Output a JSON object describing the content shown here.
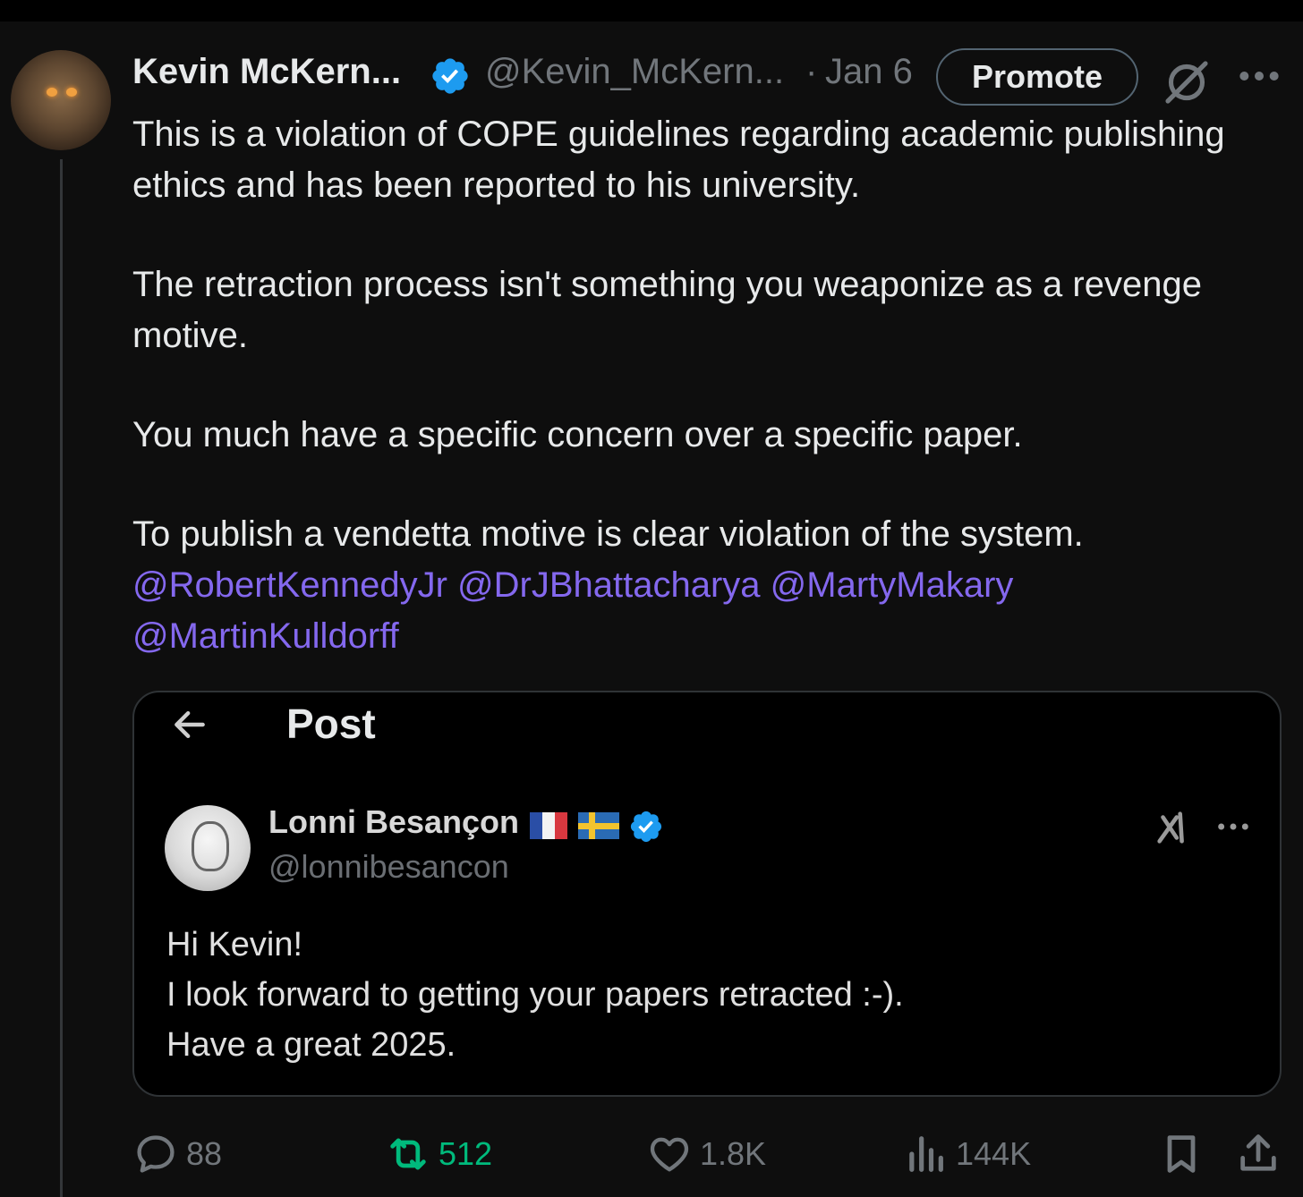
{
  "post": {
    "author_name": "Kevin McKern...",
    "author_handle": "@Kevin_McKern...",
    "separator": "·",
    "date": "Jan 6",
    "promote_label": "Promote",
    "paragraphs": [
      "This is a violation of COPE guidelines regarding academic publishing ethics and has been reported to his university.",
      "The retraction process isn't something you weaponize as a revenge motive.",
      "You much have a specific concern over a specific paper.",
      "To publish a vendetta motive is clear violation of the system."
    ],
    "mentions": [
      "@RobertKennedyJr",
      "@DrJBhattacharya",
      "@MartyMakary",
      "@MartinKulldorff"
    ]
  },
  "quoted": {
    "header_title": "Post",
    "author_name": "Lonni Besançon",
    "author_handle": "@lonnibesancon",
    "text": "Hi Kevin!\nI look forward to getting your papers retracted :-).\nHave a great 2025."
  },
  "actions": {
    "replies": "88",
    "reposts": "512",
    "likes": "1.8K",
    "views": "144K"
  },
  "icons": {
    "verified": "verified-badge-icon",
    "grok": "grok-icon",
    "more": "more-icon",
    "back": "back-arrow-icon",
    "reply": "reply-icon",
    "repost": "repost-icon",
    "like": "like-icon",
    "views": "views-icon",
    "bookmark": "bookmark-icon",
    "share": "share-icon"
  },
  "colors": {
    "background": "#0e0e0e",
    "text": "#e7e9ea",
    "secondary": "#71767b",
    "mention": "#8468ee",
    "verified": "#1d9bf0",
    "repost_active": "#00ba7c"
  }
}
